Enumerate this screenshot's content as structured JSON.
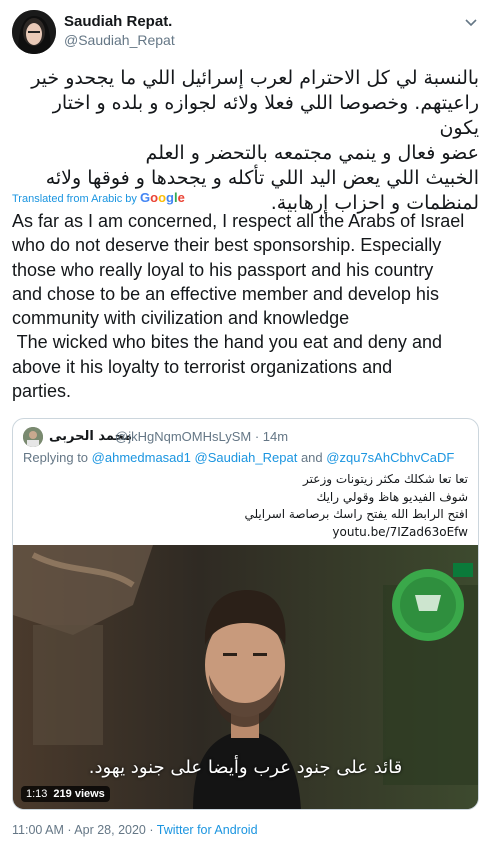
{
  "tweet": {
    "display_name": "Saudiah Repat.",
    "handle": "@Saudiah_Repat",
    "text_arabic_lines": [
      "بالنسبة لي كل الاحترام لعرب إسرائيل اللي ما يجحدو خير",
      "راعيتهم. وخصوصا اللي فعلا ولائه لجوازه و بلده و اختار يكون",
      "عضو فعال و ينمي مجتمعه بالتحضر و العلم",
      "الخبيث اللي يعض اليد اللي تأكله و يجحدها و فوقها ولائه",
      "لمنظمات و احزاب إرهابية."
    ],
    "translated_label": "Translated from Arabic by",
    "translator": "Google",
    "text_english_lines": [
      "As far as I am concerned, I respect all the Arabs of Israel",
      "who do not deserve their best sponsorship. Especially",
      "those who really loyal to his passport and his country",
      "and chose to be an effective member and develop his",
      "community with civilization and knowledge",
      " The wicked who bites the hand you eat and deny and",
      "above it his loyalty to terrorist organizations and",
      "parties."
    ],
    "timestamp": "11:00 AM · Apr 28, 2020 ·",
    "source": "Twitter for Android"
  },
  "quoted": {
    "display_name": "محمد الحربى",
    "handle": "@jkHgNqmOMHsLySM",
    "time": "· 14m",
    "reply_prefix": "Replying to",
    "reply_user_1": "@ahmedmasad1",
    "reply_user_2": "@Saudiah_Repat",
    "reply_and": "and",
    "reply_user_3": "@zqu7sAhCbhvCaDF",
    "text_lines": [
      "تعا تعا شكلك مكثر زيتونات وزعتر",
      "شوف الفيديو هاظ وقولي رايك",
      "افتح الرابط الله يفتح راسك برصاصة اسرايلي"
    ],
    "link": "youtu.be/7IZad63oEfw",
    "video": {
      "subtitle": "قائد على جنود عرب وأيضا على جنود يهود.",
      "duration": "1:13",
      "views": "219 views"
    }
  },
  "icons": {
    "menu": "chevron-down-icon",
    "translator_logo": "google-logo"
  }
}
